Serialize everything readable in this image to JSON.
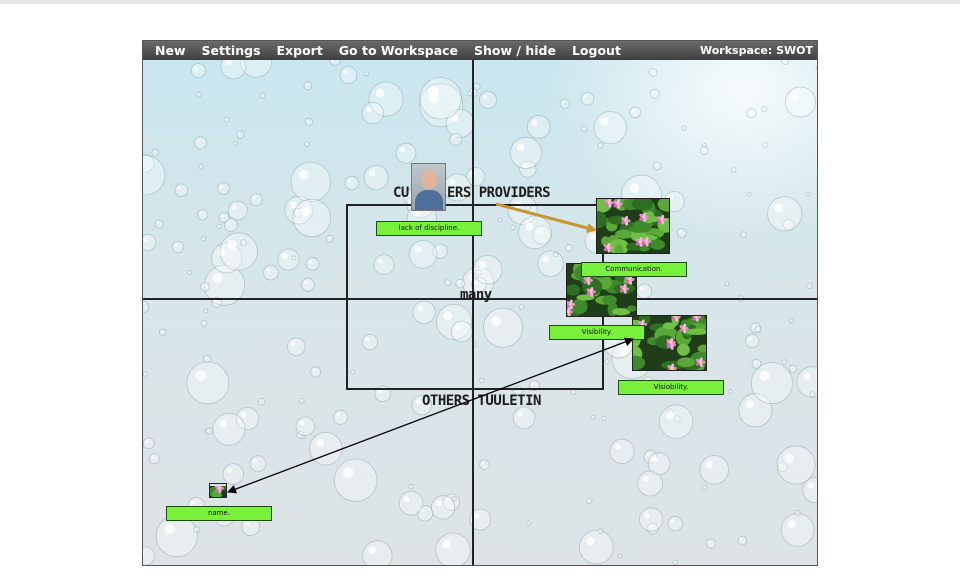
{
  "menu": {
    "items": [
      "New",
      "Settings",
      "Export",
      "Go to Workspace",
      "Show / hide",
      "Logout"
    ],
    "workspace_label": "Workspace: SWOT"
  },
  "canvas": {
    "labels": {
      "customers_left": "CU",
      "customers_right": "ERS PROVIDERS",
      "center": "many",
      "bottom": "OTHERS TUULETIN"
    },
    "notes": {
      "discipline": "lack of discipline.",
      "communication": "Communication.",
      "visibility_1": "Visibility.",
      "visibility_2": "Visiobility.",
      "name": "name."
    },
    "images": {
      "person": "person-photo",
      "water_lily": "water-lily-photo"
    }
  },
  "colors": {
    "note_bg": "#79f03a",
    "arrow_gold": "#c8962e",
    "arrow_black": "#000000",
    "menubar": "#4a4a4a"
  }
}
